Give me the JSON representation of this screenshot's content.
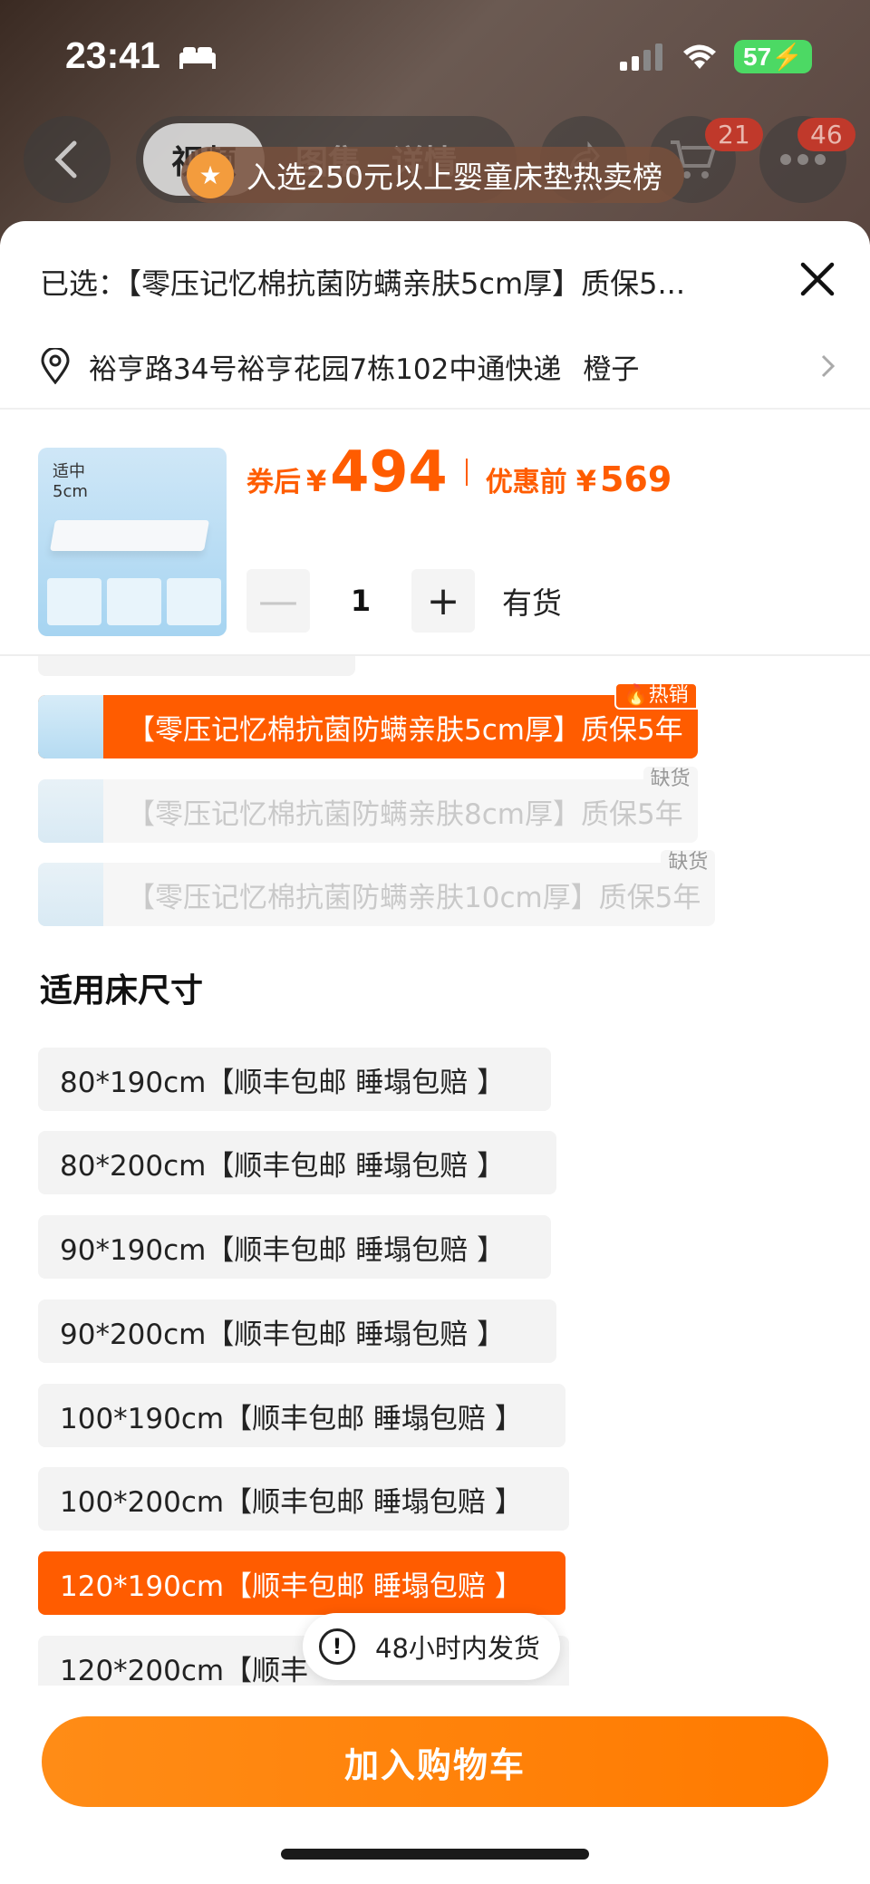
{
  "status_bar": {
    "time": "23:41",
    "battery": "57"
  },
  "nav": {
    "tabs": [
      "视频",
      "图集",
      "详情"
    ],
    "cart_count": "21",
    "more_count": "46",
    "ranking_banner": "入选250元以上婴童床垫热卖榜"
  },
  "sheet": {
    "selected_text": "已选：【零压记忆棉抗菌防螨亲肤5cm厚】质保5...",
    "address": "裕亨路34号裕亨花园7栋102中通快递",
    "recipient": "橙子"
  },
  "product": {
    "image_label_line1": "适中",
    "image_label_line2": "5cm",
    "price_label": "券后",
    "currency": "¥",
    "price": "494",
    "original_label": "优惠前",
    "original_price": "569",
    "quantity": "1",
    "stock_status": "有货"
  },
  "variants": [
    {
      "label": "【零压记忆棉抗菌防螨亲肤5cm厚】质保5年",
      "tag": "热销",
      "state": "selected"
    },
    {
      "label": "【零压记忆棉抗菌防螨亲肤8cm厚】质保5年",
      "tag": "缺货",
      "state": "disabled"
    },
    {
      "label": "【零压记忆棉抗菌防螨亲肤10cm厚】质保5年",
      "tag": "缺货",
      "state": "disabled"
    }
  ],
  "size_section": {
    "title": "适用床尺寸",
    "options": [
      "80*190cm【顺丰包邮 睡塌包赔 】",
      "80*200cm【顺丰包邮 睡塌包赔 】",
      "90*190cm【顺丰包邮 睡塌包赔 】",
      "90*200cm【顺丰包邮 睡塌包赔 】",
      "100*190cm【顺丰包邮 睡塌包赔 】",
      "100*200cm【顺丰包邮 睡塌包赔 】",
      "120*190cm【顺丰包邮 睡塌包赔 】",
      "120*200cm【顺丰"
    ],
    "selected_index": 6
  },
  "toast": {
    "text": "48小时内发货"
  },
  "actions": {
    "add_to_cart": "加入购物车"
  },
  "icons": {
    "back": "back-arrow-icon",
    "share": "share-icon",
    "cart": "cart-icon",
    "more": "more-icon",
    "close": "close-icon",
    "location": "location-pin-icon",
    "chevron": "chevron-right-icon",
    "fire": "fire-icon",
    "alert": "alert-icon"
  },
  "colors": {
    "accent": "#ff5c00",
    "cart_button": "#ff8c16",
    "battery": "#4cd964"
  }
}
